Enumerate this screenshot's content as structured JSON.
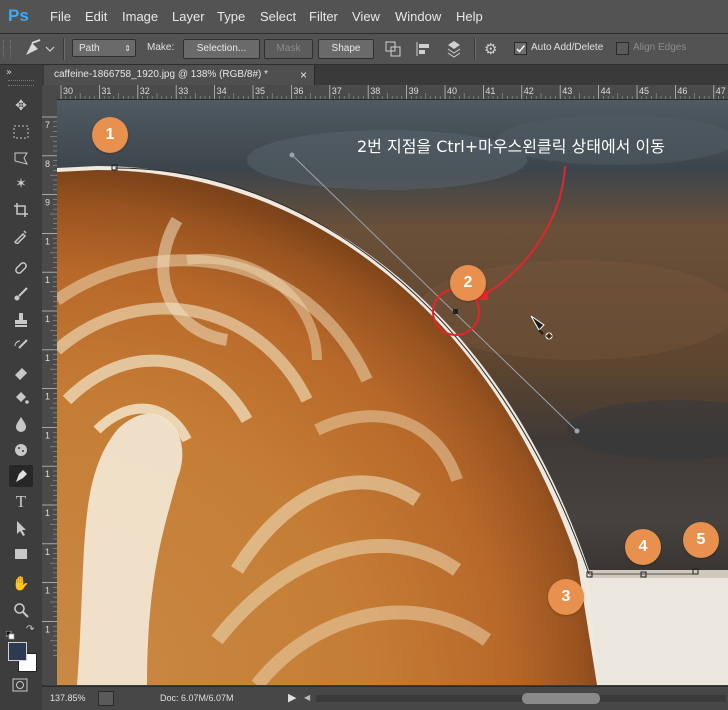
{
  "app": {
    "logo": "Ps"
  },
  "menu": [
    "File",
    "Edit",
    "Image",
    "Layer",
    "Type",
    "Select",
    "Filter",
    "View",
    "Window",
    "Help"
  ],
  "options_bar": {
    "tool_icon": "pen-icon",
    "mode": "Path",
    "make_label": "Make:",
    "selection": "Selection...",
    "mask": "Mask",
    "shape": "Shape",
    "auto_add_delete": {
      "label": "Auto Add/Delete",
      "checked": true
    },
    "align_edges": {
      "label": "Align Edges",
      "checked": false
    }
  },
  "document_tab": {
    "title": "caffeine-1866758_1920.jpg @ 138% (RGB/8#) *",
    "close": "×"
  },
  "toolbox_expand": "»",
  "ruler": {
    "h_ticks": [
      "30",
      "31",
      "32",
      "33",
      "34",
      "35",
      "36",
      "37",
      "38",
      "39",
      "40",
      "41",
      "42",
      "43",
      "44",
      "45",
      "46",
      "47"
    ],
    "v_ticks": [
      "7",
      "8",
      "9",
      "1",
      "1",
      "1",
      "1",
      "1",
      "1",
      "1",
      "1",
      "1",
      "1",
      "1"
    ]
  },
  "canvas": {
    "instruction": "2번 지점을 Ctrl+마우스왼클릭 상태에서 이동",
    "markers": [
      "1",
      "2",
      "3",
      "4",
      "5"
    ]
  },
  "statusbar": {
    "zoom": "137.85%",
    "doc": "Doc: 6.07M/6.07M"
  }
}
